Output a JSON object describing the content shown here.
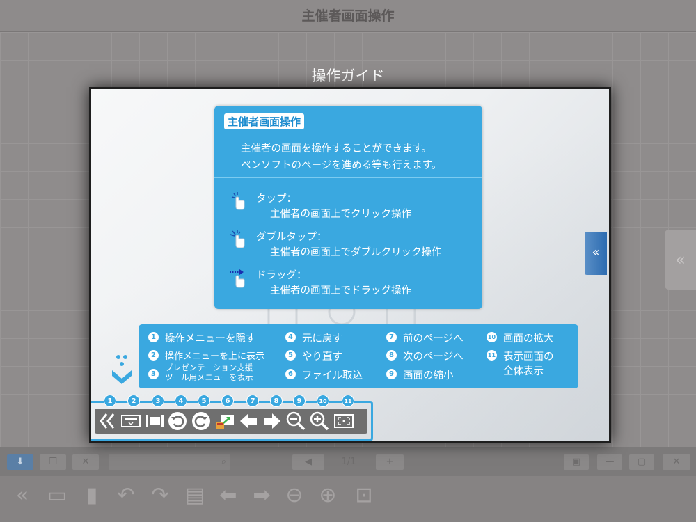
{
  "app": {
    "title": "主催者画面操作"
  },
  "overlay": {
    "title": "操作ガイド"
  },
  "help": {
    "title": "主催者画面操作",
    "desc_line1": "主催者の画面を操作することができます。",
    "desc_line2": "ペンソフトのページを進める等も行えます。",
    "gestures": [
      {
        "icon": "tap-hand-icon",
        "name": "タップ：",
        "desc": "主催者の画面上でクリック操作"
      },
      {
        "icon": "double-tap-hand-icon",
        "name": "ダブルタップ：",
        "desc": "主催者の画面上でダブルクリック操作"
      },
      {
        "icon": "drag-hand-icon",
        "name": "ドラッグ：",
        "desc": "主催者の画面上でドラッグ操作"
      }
    ]
  },
  "legend": {
    "items": [
      {
        "num": "1",
        "label": "操作メニューを隠す"
      },
      {
        "num": "2",
        "label": "操作メニューを上に表示"
      },
      {
        "num": "3",
        "label_line1": "プレゼンテーション支援",
        "label_line2": "ツール用メニューを表示"
      },
      {
        "num": "4",
        "label": "元に戻す"
      },
      {
        "num": "5",
        "label": "やり直す"
      },
      {
        "num": "6",
        "label": "ファイル取込"
      },
      {
        "num": "7",
        "label": "前のページへ"
      },
      {
        "num": "8",
        "label": "次のページへ"
      },
      {
        "num": "9",
        "label": "画面の縮小"
      },
      {
        "num": "10",
        "label": "画面の拡大"
      },
      {
        "num": "11",
        "label_line1": "表示画面の",
        "label_line2": "全体表示"
      }
    ]
  },
  "toolbar": {
    "badges": [
      "1",
      "2",
      "3",
      "4",
      "5",
      "6",
      "7",
      "8",
      "9",
      "10",
      "11"
    ],
    "icons": [
      "collapse-menu-icon",
      "menu-top-icon",
      "presentation-menu-icon",
      "undo-icon",
      "redo-icon",
      "file-import-icon",
      "prev-page-icon",
      "next-page-icon",
      "zoom-out-icon",
      "zoom-in-icon",
      "fit-screen-icon"
    ]
  },
  "side_tab": {
    "glyph": "«"
  },
  "background_toolbar": {
    "page_indicator": "1/1"
  },
  "colors": {
    "accent": "#3aa8e0",
    "toolbar": "#6f6f6f",
    "side_tab": "#2c6bb0",
    "dim_background": "#8c8c8c"
  }
}
